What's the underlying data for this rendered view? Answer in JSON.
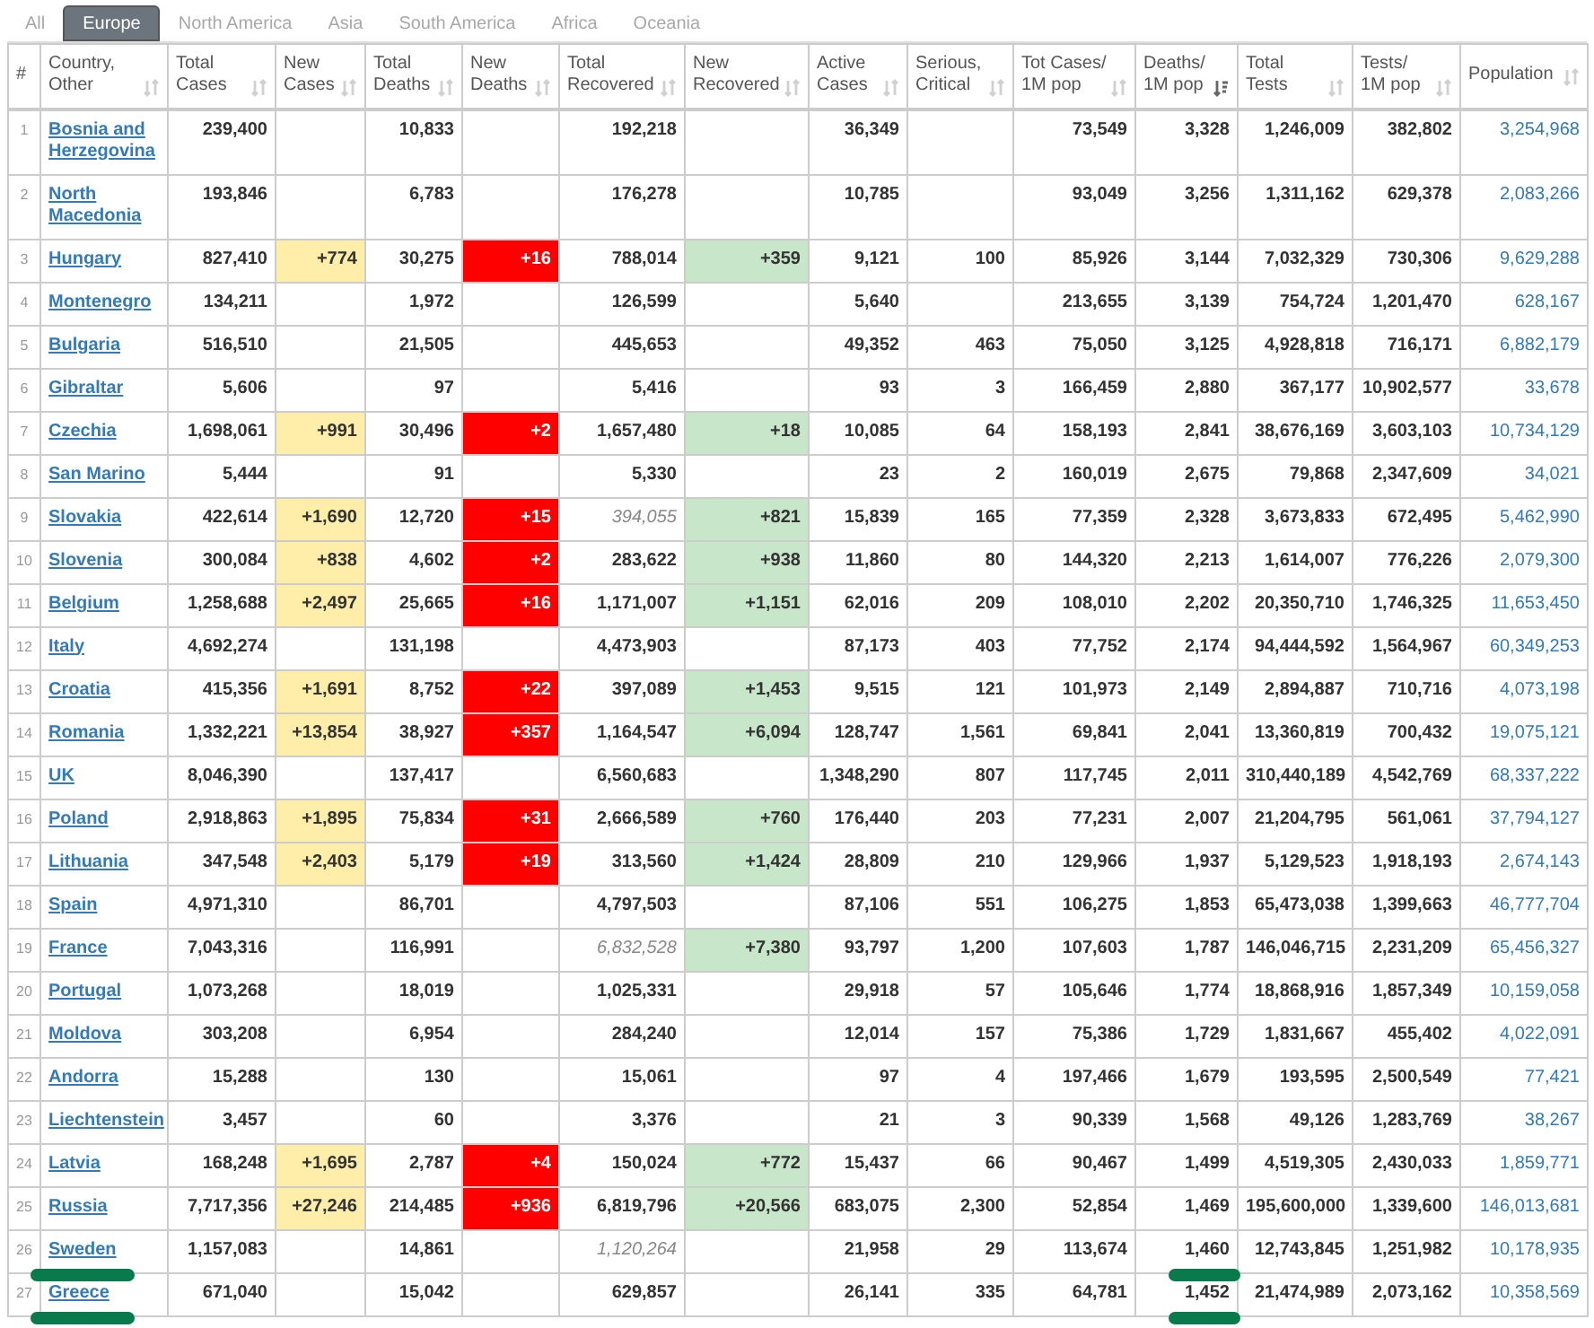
{
  "tabs": [
    {
      "label": "All",
      "selected": false
    },
    {
      "label": "Europe",
      "selected": true
    },
    {
      "label": "North America",
      "selected": false
    },
    {
      "label": "Asia",
      "selected": false
    },
    {
      "label": "South America",
      "selected": false
    },
    {
      "label": "Africa",
      "selected": false
    },
    {
      "label": "Oceania",
      "selected": false
    }
  ],
  "table": {
    "columns": [
      {
        "lines": [
          "#"
        ],
        "kind": "index"
      },
      {
        "lines": [
          "Country,",
          "Other"
        ],
        "kind": "country",
        "sorted": false
      },
      {
        "lines": [
          "Total",
          "Cases"
        ],
        "kind": "number",
        "sorted": false
      },
      {
        "lines": [
          "New",
          "Cases"
        ],
        "kind": "new_cases",
        "sorted": false
      },
      {
        "lines": [
          "Total",
          "Deaths"
        ],
        "kind": "number",
        "sorted": false
      },
      {
        "lines": [
          "New",
          "Deaths"
        ],
        "kind": "new_deaths",
        "sorted": false
      },
      {
        "lines": [
          "Total",
          "Recovered"
        ],
        "kind": "recovered",
        "sorted": false
      },
      {
        "lines": [
          "New",
          "Recovered"
        ],
        "kind": "new_recovered",
        "sorted": false
      },
      {
        "lines": [
          "Active",
          "Cases"
        ],
        "kind": "number",
        "sorted": false
      },
      {
        "lines": [
          "Serious,",
          "Critical"
        ],
        "kind": "number",
        "sorted": false
      },
      {
        "lines": [
          "Tot Cases/",
          "1M pop"
        ],
        "kind": "number",
        "sorted": false
      },
      {
        "lines": [
          "Deaths/",
          "1M pop"
        ],
        "kind": "deaths_per_million",
        "sorted": true
      },
      {
        "lines": [
          "Total",
          "Tests"
        ],
        "kind": "number",
        "sorted": false
      },
      {
        "lines": [
          "Tests/",
          "1M pop"
        ],
        "kind": "number",
        "sorted": false
      },
      {
        "lines": [
          "Population"
        ],
        "kind": "population",
        "sorted": false
      }
    ],
    "rows": [
      {
        "recovered_estimated": false,
        "marked": false,
        "cells": [
          "1",
          "Bosnia and Herzegovina",
          "239,400",
          null,
          "10,833",
          null,
          "192,218",
          null,
          "36,349",
          null,
          "73,549",
          "3,328",
          "1,246,009",
          "382,802",
          "3,254,968"
        ]
      },
      {
        "recovered_estimated": false,
        "marked": false,
        "cells": [
          "2",
          "North Macedonia",
          "193,846",
          null,
          "6,783",
          null,
          "176,278",
          null,
          "10,785",
          null,
          "93,049",
          "3,256",
          "1,311,162",
          "629,378",
          "2,083,266"
        ]
      },
      {
        "recovered_estimated": false,
        "marked": false,
        "cells": [
          "3",
          "Hungary",
          "827,410",
          "+774",
          "30,275",
          "+16",
          "788,014",
          "+359",
          "9,121",
          "100",
          "85,926",
          "3,144",
          "7,032,329",
          "730,306",
          "9,629,288"
        ]
      },
      {
        "recovered_estimated": false,
        "marked": false,
        "cells": [
          "4",
          "Montenegro",
          "134,211",
          null,
          "1,972",
          null,
          "126,599",
          null,
          "5,640",
          null,
          "213,655",
          "3,139",
          "754,724",
          "1,201,470",
          "628,167"
        ]
      },
      {
        "recovered_estimated": false,
        "marked": false,
        "cells": [
          "5",
          "Bulgaria",
          "516,510",
          null,
          "21,505",
          null,
          "445,653",
          null,
          "49,352",
          "463",
          "75,050",
          "3,125",
          "4,928,818",
          "716,171",
          "6,882,179"
        ]
      },
      {
        "recovered_estimated": false,
        "marked": false,
        "cells": [
          "6",
          "Gibraltar",
          "5,606",
          null,
          "97",
          null,
          "5,416",
          null,
          "93",
          "3",
          "166,459",
          "2,880",
          "367,177",
          "10,902,577",
          "33,678"
        ]
      },
      {
        "recovered_estimated": false,
        "marked": false,
        "cells": [
          "7",
          "Czechia",
          "1,698,061",
          "+991",
          "30,496",
          "+2",
          "1,657,480",
          "+18",
          "10,085",
          "64",
          "158,193",
          "2,841",
          "38,676,169",
          "3,603,103",
          "10,734,129"
        ]
      },
      {
        "recovered_estimated": false,
        "marked": false,
        "cells": [
          "8",
          "San Marino",
          "5,444",
          null,
          "91",
          null,
          "5,330",
          null,
          "23",
          "2",
          "160,019",
          "2,675",
          "79,868",
          "2,347,609",
          "34,021"
        ]
      },
      {
        "recovered_estimated": true,
        "marked": false,
        "cells": [
          "9",
          "Slovakia",
          "422,614",
          "+1,690",
          "12,720",
          "+15",
          "394,055",
          "+821",
          "15,839",
          "165",
          "77,359",
          "2,328",
          "3,673,833",
          "672,495",
          "5,462,990"
        ]
      },
      {
        "recovered_estimated": false,
        "marked": false,
        "cells": [
          "10",
          "Slovenia",
          "300,084",
          "+838",
          "4,602",
          "+2",
          "283,622",
          "+938",
          "11,860",
          "80",
          "144,320",
          "2,213",
          "1,614,007",
          "776,226",
          "2,079,300"
        ]
      },
      {
        "recovered_estimated": false,
        "marked": false,
        "cells": [
          "11",
          "Belgium",
          "1,258,688",
          "+2,497",
          "25,665",
          "+16",
          "1,171,007",
          "+1,151",
          "62,016",
          "209",
          "108,010",
          "2,202",
          "20,350,710",
          "1,746,325",
          "11,653,450"
        ]
      },
      {
        "recovered_estimated": false,
        "marked": false,
        "cells": [
          "12",
          "Italy",
          "4,692,274",
          null,
          "131,198",
          null,
          "4,473,903",
          null,
          "87,173",
          "403",
          "77,752",
          "2,174",
          "94,444,592",
          "1,564,967",
          "60,349,253"
        ]
      },
      {
        "recovered_estimated": false,
        "marked": false,
        "cells": [
          "13",
          "Croatia",
          "415,356",
          "+1,691",
          "8,752",
          "+22",
          "397,089",
          "+1,453",
          "9,515",
          "121",
          "101,973",
          "2,149",
          "2,894,887",
          "710,716",
          "4,073,198"
        ]
      },
      {
        "recovered_estimated": false,
        "marked": false,
        "cells": [
          "14",
          "Romania",
          "1,332,221",
          "+13,854",
          "38,927",
          "+357",
          "1,164,547",
          "+6,094",
          "128,747",
          "1,561",
          "69,841",
          "2,041",
          "13,360,819",
          "700,432",
          "19,075,121"
        ]
      },
      {
        "recovered_estimated": false,
        "marked": false,
        "cells": [
          "15",
          "UK",
          "8,046,390",
          null,
          "137,417",
          null,
          "6,560,683",
          null,
          "1,348,290",
          "807",
          "117,745",
          "2,011",
          "310,440,189",
          "4,542,769",
          "68,337,222"
        ]
      },
      {
        "recovered_estimated": false,
        "marked": false,
        "cells": [
          "16",
          "Poland",
          "2,918,863",
          "+1,895",
          "75,834",
          "+31",
          "2,666,589",
          "+760",
          "176,440",
          "203",
          "77,231",
          "2,007",
          "21,204,795",
          "561,061",
          "37,794,127"
        ]
      },
      {
        "recovered_estimated": false,
        "marked": false,
        "cells": [
          "17",
          "Lithuania",
          "347,548",
          "+2,403",
          "5,179",
          "+19",
          "313,560",
          "+1,424",
          "28,809",
          "210",
          "129,966",
          "1,937",
          "5,129,523",
          "1,918,193",
          "2,674,143"
        ]
      },
      {
        "recovered_estimated": false,
        "marked": false,
        "cells": [
          "18",
          "Spain",
          "4,971,310",
          null,
          "86,701",
          null,
          "4,797,503",
          null,
          "87,106",
          "551",
          "106,275",
          "1,853",
          "65,473,038",
          "1,399,663",
          "46,777,704"
        ]
      },
      {
        "recovered_estimated": true,
        "marked": false,
        "cells": [
          "19",
          "France",
          "7,043,316",
          null,
          "116,991",
          null,
          "6,832,528",
          "+7,380",
          "93,797",
          "1,200",
          "107,603",
          "1,787",
          "146,046,715",
          "2,231,209",
          "65,456,327"
        ]
      },
      {
        "recovered_estimated": false,
        "marked": false,
        "cells": [
          "20",
          "Portugal",
          "1,073,268",
          null,
          "18,019",
          null,
          "1,025,331",
          null,
          "29,918",
          "57",
          "105,646",
          "1,774",
          "18,868,916",
          "1,857,349",
          "10,159,058"
        ]
      },
      {
        "recovered_estimated": false,
        "marked": false,
        "cells": [
          "21",
          "Moldova",
          "303,208",
          null,
          "6,954",
          null,
          "284,240",
          null,
          "12,014",
          "157",
          "75,386",
          "1,729",
          "1,831,667",
          "455,402",
          "4,022,091"
        ]
      },
      {
        "recovered_estimated": false,
        "marked": false,
        "cells": [
          "22",
          "Andorra",
          "15,288",
          null,
          "130",
          null,
          "15,061",
          null,
          "97",
          "4",
          "197,466",
          "1,679",
          "193,595",
          "2,500,549",
          "77,421"
        ]
      },
      {
        "recovered_estimated": false,
        "marked": false,
        "cells": [
          "23",
          "Liechtenstein",
          "3,457",
          null,
          "60",
          null,
          "3,376",
          null,
          "21",
          "3",
          "90,339",
          "1,568",
          "49,126",
          "1,283,769",
          "38,267"
        ]
      },
      {
        "recovered_estimated": false,
        "marked": false,
        "cells": [
          "24",
          "Latvia",
          "168,248",
          "+1,695",
          "2,787",
          "+4",
          "150,024",
          "+772",
          "15,437",
          "66",
          "90,467",
          "1,499",
          "4,519,305",
          "2,430,033",
          "1,859,771"
        ]
      },
      {
        "recovered_estimated": false,
        "marked": false,
        "cells": [
          "25",
          "Russia",
          "7,717,356",
          "+27,246",
          "214,485",
          "+936",
          "6,819,796",
          "+20,566",
          "683,075",
          "2,300",
          "52,854",
          "1,469",
          "195,600,000",
          "1,339,600",
          "146,013,681"
        ]
      },
      {
        "recovered_estimated": true,
        "marked": true,
        "cells": [
          "26",
          "Sweden",
          "1,157,083",
          null,
          "14,861",
          null,
          "1,120,264",
          null,
          "21,958",
          "29",
          "113,674",
          "1,460",
          "12,743,845",
          "1,251,982",
          "10,178,935"
        ]
      },
      {
        "recovered_estimated": false,
        "marked": true,
        "cells": [
          "27",
          "Greece",
          "671,040",
          null,
          "15,042",
          null,
          "629,857",
          null,
          "26,141",
          "335",
          "64,781",
          "1,452",
          "21,474,989",
          "2,073,162",
          "10,358,569"
        ]
      }
    ]
  }
}
